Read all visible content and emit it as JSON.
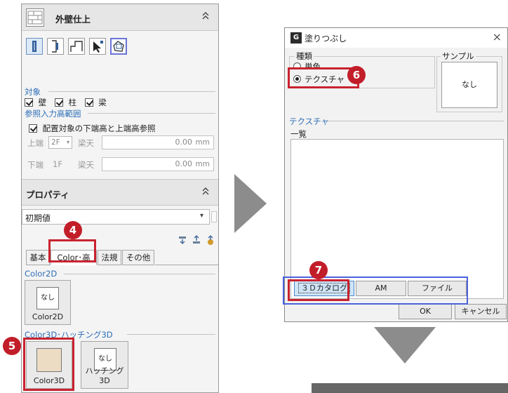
{
  "left_panel": {
    "wall_finish": {
      "title": "外壁仕上",
      "collapse_glyph": "⌃"
    },
    "target": {
      "label": "対象",
      "wall": "壁",
      "column": "柱",
      "beam": "梁"
    },
    "height_ref": {
      "label": "参照入力高範囲",
      "checkbox_label": "配置対象の下端高と上端高参照",
      "top_label": "上端",
      "top_floor": "2F",
      "top_ref": "梁天",
      "top_value": "0.00",
      "unit": "mm",
      "bottom_label": "下端",
      "bottom_floor": "1F",
      "bottom_ref": "梁天",
      "bottom_value": "0.00"
    },
    "properties": {
      "title": "プロパティ",
      "collapse_glyph": "⌃",
      "preset": "初期値"
    },
    "tabs": [
      "基本",
      "Color･高",
      "法規",
      "その他"
    ],
    "color2d": {
      "group_label": "Color2D",
      "swatch_text": "なし",
      "caption": "Color2D"
    },
    "color3d": {
      "group_label": "Color3D･ハッチング3D",
      "color_caption": "Color3D",
      "color_value": "#ecdcc4",
      "hatch_text": "なし",
      "hatch_caption": "ハッチング3D"
    }
  },
  "dialog": {
    "app_icon": "G",
    "title": "塗りつぶし",
    "close": "×",
    "kind": {
      "label": "種類",
      "solid": "単色",
      "texture": "テクスチャ"
    },
    "sample": {
      "label": "サンプル",
      "value": "なし"
    },
    "texture_label": "テクスチャ",
    "list_label": "一覧",
    "buttons": {
      "catalog": "３Ｄカタログ",
      "am": "AM",
      "file": "ファイル",
      "ok": "OK",
      "cancel": "キャンセル"
    }
  },
  "steps": {
    "s4": "4",
    "s5": "5",
    "s6": "6",
    "s7": "7"
  },
  "colors": {
    "highlight_red": "#c9232f",
    "badge_red": "#c21e2a",
    "highlight_blue": "#4a62dc",
    "arrow_gray": "#8c8c8c"
  }
}
